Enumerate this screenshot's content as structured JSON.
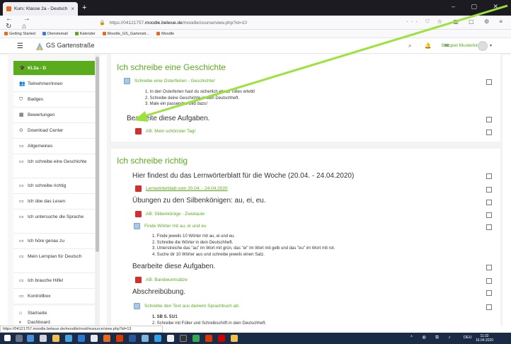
{
  "browser": {
    "tab_title": "Kurs: Klasse 2a - Deutsch",
    "url_prefix": "https://04121757.",
    "url_domain": "moodle.belwue.de",
    "url_path": "/moodle/course/view.php?id=10",
    "bookmarks": [
      "Getting Started",
      "Dienstemail",
      "Kalender",
      "Moodle_GS_Gartenstr...",
      "Moodle"
    ]
  },
  "header": {
    "site_name": "GS Gartenstraße",
    "user_name": "Beispiel Musterkind"
  },
  "drawer": {
    "active": "Kl.2a - D",
    "items": [
      {
        "label": "Teilnehmer/innen",
        "icon": "users-icon"
      },
      {
        "label": "Badges",
        "icon": "shield-icon"
      },
      {
        "label": "Bewertungen",
        "icon": "grid-icon"
      },
      {
        "label": "Download Center",
        "icon": "download-icon"
      },
      {
        "label": "Allgemeines",
        "icon": "folder-icon"
      },
      {
        "label": "Ich schreibe eine Geschichte",
        "icon": "folder-icon"
      },
      {
        "label": "Ich schreibe richtig",
        "icon": "folder-icon"
      },
      {
        "label": "Ich übe das Lesen",
        "icon": "folder-icon"
      },
      {
        "label": "Ich untersuche die Sprache",
        "icon": "folder-icon"
      },
      {
        "label": "Ich höre genau zu",
        "icon": "folder-icon"
      },
      {
        "label": "Mein Lernplan für Deutsch",
        "icon": "folder-icon"
      },
      {
        "label": "Ich brauche Hilfe!",
        "icon": "folder-icon"
      },
      {
        "label": "Kontrollbox",
        "icon": "folder-icon"
      },
      {
        "label": "Startseite",
        "icon": "home-icon"
      },
      {
        "label": "Dashboard",
        "icon": "dashboard-icon"
      }
    ]
  },
  "section1": {
    "title": "Ich schreibe eine Geschichte",
    "res1": "Schreibe eine Osterferien - Geschichte!",
    "steps": [
      "1. In den Osterferien hast du sicherlich etwas Tolles erlebt!",
      "2. Schreibe deine Geschichte in dein Deutschheft.",
      "3. Male ein passendes Bild dazu!"
    ],
    "label1": "Bearbeite diese Aufgaben.",
    "res2": "AB: Mein schönster Tag!"
  },
  "section2": {
    "title": "Ich schreibe richtig",
    "label1": "Hier findest du das Lernwörterblatt für die Woche (20.04. - 24.04.2020)",
    "res1": "Lernwörterblatt vom 20.04. - 24.04.2020",
    "label2": "Übungen zu den Silbenkönigen: au, ei, eu.",
    "res2": "AB: Silbenkönige - Zwielaute",
    "res3": "Finde Wörter mit au, ei und eu",
    "steps": [
      "1. Finde jeweils 10 Wörter mit au, ei und eu.",
      "2. Schreibe die Wörter in dein Deutschheft.",
      "3. Unterstreiche das \"au\" im Wort mit grün, das \"ei\" im Wort mit gelb und das \"eu\" im Wort mit rot.",
      "4. Suche dir 10 Wörter aus und schreibe jeweils einen Satz."
    ],
    "label3": "Bearbeite diese Aufgaben.",
    "res4": "AB: Bandwurmsätze",
    "label4": "Abschreibübung.",
    "res5": "Schreibe den Text aus deinem Sprachbuch ab:",
    "steps2": [
      "1. SB S.  51/1",
      "2. Schreibe mit Füller und Schreibschrift in dein Deutschheft."
    ]
  },
  "status_url": "https://04121757.moodle.belwue.de/moodle/mod/resource/view.php?id=13",
  "taskbar": {
    "lang": "DEU",
    "time": "11:32",
    "date": "16.04.2020"
  },
  "colors": {
    "accent": "#5aab1d",
    "arrow": "#9be33a"
  }
}
